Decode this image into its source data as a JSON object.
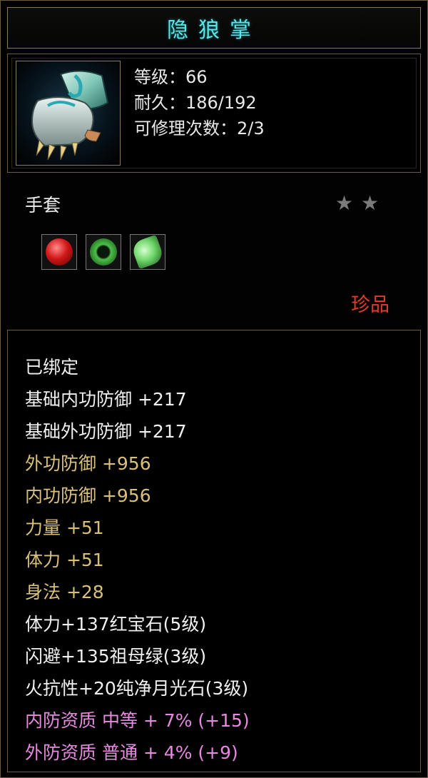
{
  "item": {
    "name": "隐狼掌",
    "level_line": "等级：66",
    "durability_line": "耐久：186/192",
    "repair_line": "可修理次数：2/3",
    "type": "手套",
    "stars": [
      "★",
      "★"
    ],
    "gems": [
      "ruby",
      "emerald",
      "moonstone"
    ],
    "rarity": "珍品"
  },
  "colors": {
    "title": "#5fe3e6",
    "base_attr": "#f0f0f0",
    "bonus_attr": "#d9c07a",
    "quality_attr": "#e68ae0",
    "rarity": "#e23a2e"
  },
  "attributes": [
    {
      "text": "已绑定",
      "style": "white"
    },
    {
      "text": "基础内功防御  +217",
      "style": "white"
    },
    {
      "text": "基础外功防御  +217",
      "style": "white"
    },
    {
      "text": "外功防御  +956",
      "style": "gold"
    },
    {
      "text": "内功防御  +956",
      "style": "gold"
    },
    {
      "text": "力量  +51",
      "style": "gold"
    },
    {
      "text": "体力  +51",
      "style": "gold"
    },
    {
      "text": "身法  +28",
      "style": "gold"
    },
    {
      "text": "体力+137红宝石(5级)",
      "style": "white"
    },
    {
      "text": "闪避+135祖母绿(3级)",
      "style": "white"
    },
    {
      "text": "火抗性+20纯净月光石(3级)",
      "style": "white"
    },
    {
      "text": "内防资质  中等  +  7% (+15)",
      "style": "pink"
    },
    {
      "text": "外防资质  普通  +  4% (+9)",
      "style": "pink"
    }
  ]
}
